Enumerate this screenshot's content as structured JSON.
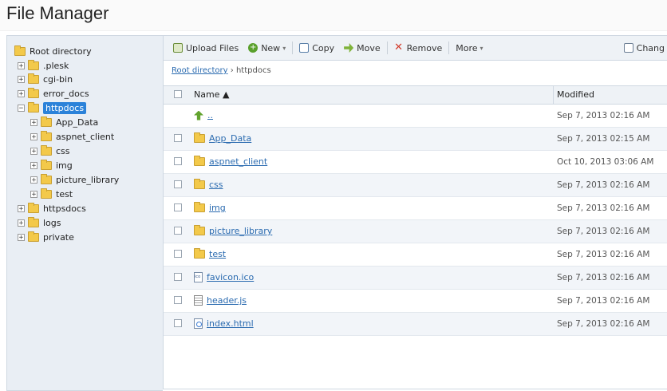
{
  "app": {
    "title": "File Manager"
  },
  "sidebar": {
    "root": "Root directory",
    "items": [
      {
        "label": ".plesk",
        "expander": "+"
      },
      {
        "label": "cgi-bin",
        "expander": "+"
      },
      {
        "label": "error_docs",
        "expander": "+"
      },
      {
        "label": "httpdocs",
        "expander": "−"
      },
      {
        "label": "App_Data",
        "expander": "+"
      },
      {
        "label": "aspnet_client",
        "expander": "+"
      },
      {
        "label": "css",
        "expander": "+"
      },
      {
        "label": "img",
        "expander": "+"
      },
      {
        "label": "picture_library",
        "expander": "+"
      },
      {
        "label": "test",
        "expander": "+"
      },
      {
        "label": "httpsdocs",
        "expander": "+"
      },
      {
        "label": "logs",
        "expander": "+"
      },
      {
        "label": "private",
        "expander": "+"
      }
    ]
  },
  "toolbar": {
    "upload": "Upload Files",
    "new": "New",
    "copy": "Copy",
    "move": "Move",
    "remove": "Remove",
    "more": "More",
    "change": "Chang",
    "new_icon": "+",
    "remove_icon": "✕",
    "caret": "▾"
  },
  "breadcrumb": {
    "root": "Root directory",
    "sep": "›",
    "current": "httpdocs"
  },
  "table": {
    "headers": {
      "name": "Name ▲",
      "modified": "Modified"
    },
    "rows": [
      {
        "name": "..",
        "modified": "Sep 7, 2013 02:16 AM"
      },
      {
        "name": "App_Data",
        "modified": "Sep 7, 2013 02:15 AM"
      },
      {
        "name": "aspnet_client",
        "modified": "Oct 10, 2013 03:06 AM"
      },
      {
        "name": "css",
        "modified": "Sep 7, 2013 02:16 AM"
      },
      {
        "name": "img",
        "modified": "Sep 7, 2013 02:16 AM"
      },
      {
        "name": "picture_library",
        "modified": "Sep 7, 2013 02:16 AM"
      },
      {
        "name": "test",
        "modified": "Sep 7, 2013 02:16 AM"
      },
      {
        "name": "favicon.ico",
        "modified": "Sep 7, 2013 02:16 AM"
      },
      {
        "name": "header.js",
        "modified": "Sep 7, 2013 02:16 AM"
      },
      {
        "name": "index.html",
        "modified": "Sep 7, 2013 02:16 AM"
      }
    ]
  }
}
